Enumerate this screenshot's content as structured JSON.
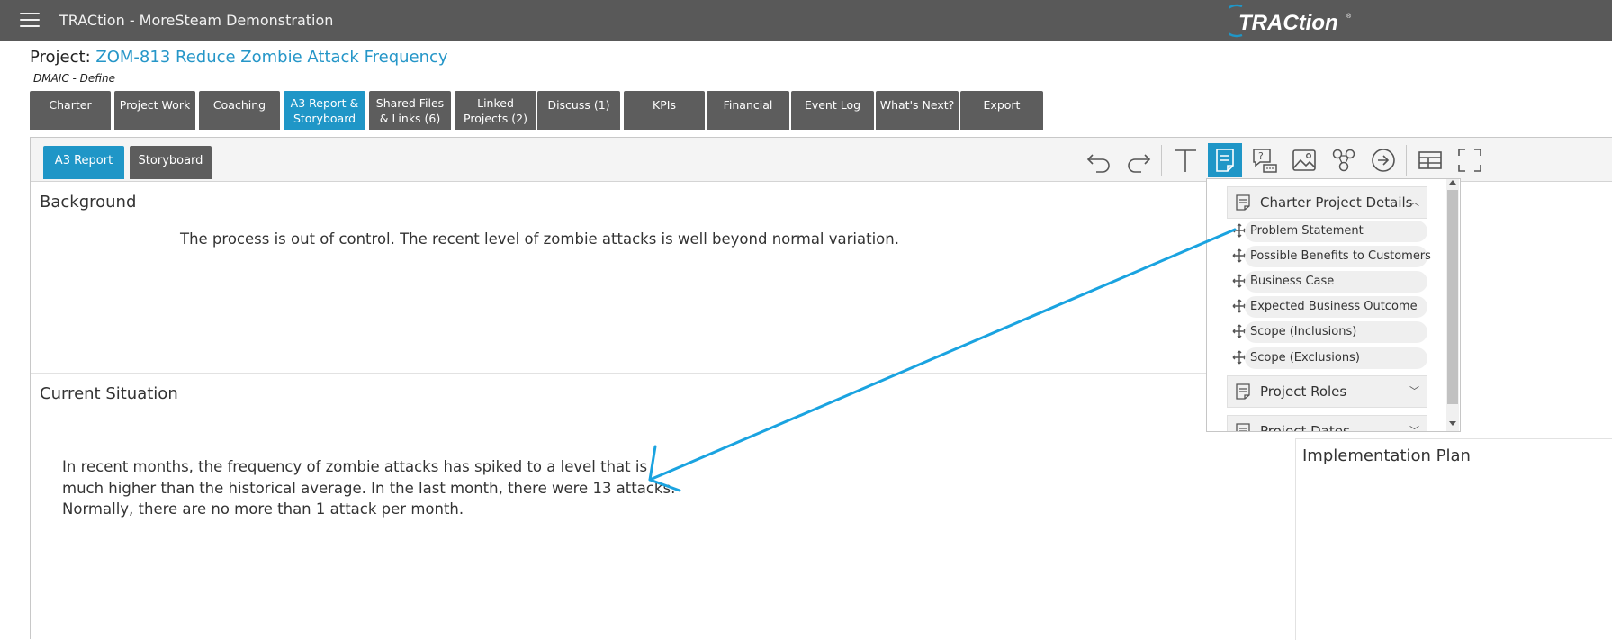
{
  "app": {
    "title": "TRACtion - MoreSteam Demonstration",
    "logo_text": "TRACtion"
  },
  "project": {
    "label": "Project:",
    "name": "ZOM-813 Reduce Zombie Attack Frequency",
    "phase": "DMAIC - Define"
  },
  "tabs": [
    {
      "line1": "Charter",
      "line2": ""
    },
    {
      "line1": "Project Work",
      "line2": ""
    },
    {
      "line1": "Coaching",
      "line2": ""
    },
    {
      "line1": "A3 Report &",
      "line2": "Storyboard"
    },
    {
      "line1": "Shared Files",
      "line2": "& Links (6)"
    },
    {
      "line1": "Linked",
      "line2": "Projects (2)"
    },
    {
      "line1": "Discuss (1)",
      "line2": ""
    },
    {
      "line1": "KPIs",
      "line2": ""
    },
    {
      "line1": "Financial",
      "line2": ""
    },
    {
      "line1": "Event Log",
      "line2": ""
    },
    {
      "line1": "What's Next?",
      "line2": ""
    },
    {
      "line1": "Export",
      "line2": ""
    }
  ],
  "active_tab": "A3 Report & Storyboard",
  "subtabs": {
    "a3": "A3 Report",
    "storyboard": "Storyboard"
  },
  "toolbar_icons": [
    "undo-icon",
    "redo-icon",
    "text-icon",
    "data-field-icon",
    "question-comment-icon",
    "image-icon",
    "diagram-icon",
    "arrow-icon",
    "table-icon",
    "fullscreen-icon"
  ],
  "sections": {
    "background": {
      "title": "Background",
      "text": "The process is out of control.  The recent level of zombie attacks is well beyond normal variation."
    },
    "current_situation": {
      "title": "Current Situation",
      "lines": [
        "In recent months, the frequency of zombie attacks has spiked to a level that is",
        "much higher than the historical average.  In the last month, there were 13 attacks.",
        "Normally, there are no more than 1 attack per month."
      ]
    },
    "implementation_plan": {
      "title": "Implementation Plan"
    }
  },
  "field_picker": {
    "groups": [
      {
        "title": "Charter Project Details",
        "expanded": true
      },
      {
        "title": "Project Roles",
        "expanded": false
      },
      {
        "title": "Project Dates",
        "expanded": false
      }
    ],
    "items": [
      "Problem Statement",
      "Possible Benefits to Customers",
      "Business Case",
      "Expected Business Outcome",
      "Scope (Inclusions)",
      "Scope (Exclusions)"
    ]
  },
  "colors": {
    "accent": "#1f96c7",
    "tab_bg": "#5d5d5d",
    "topbar": "#595959",
    "arrow": "#1aa3e0"
  }
}
